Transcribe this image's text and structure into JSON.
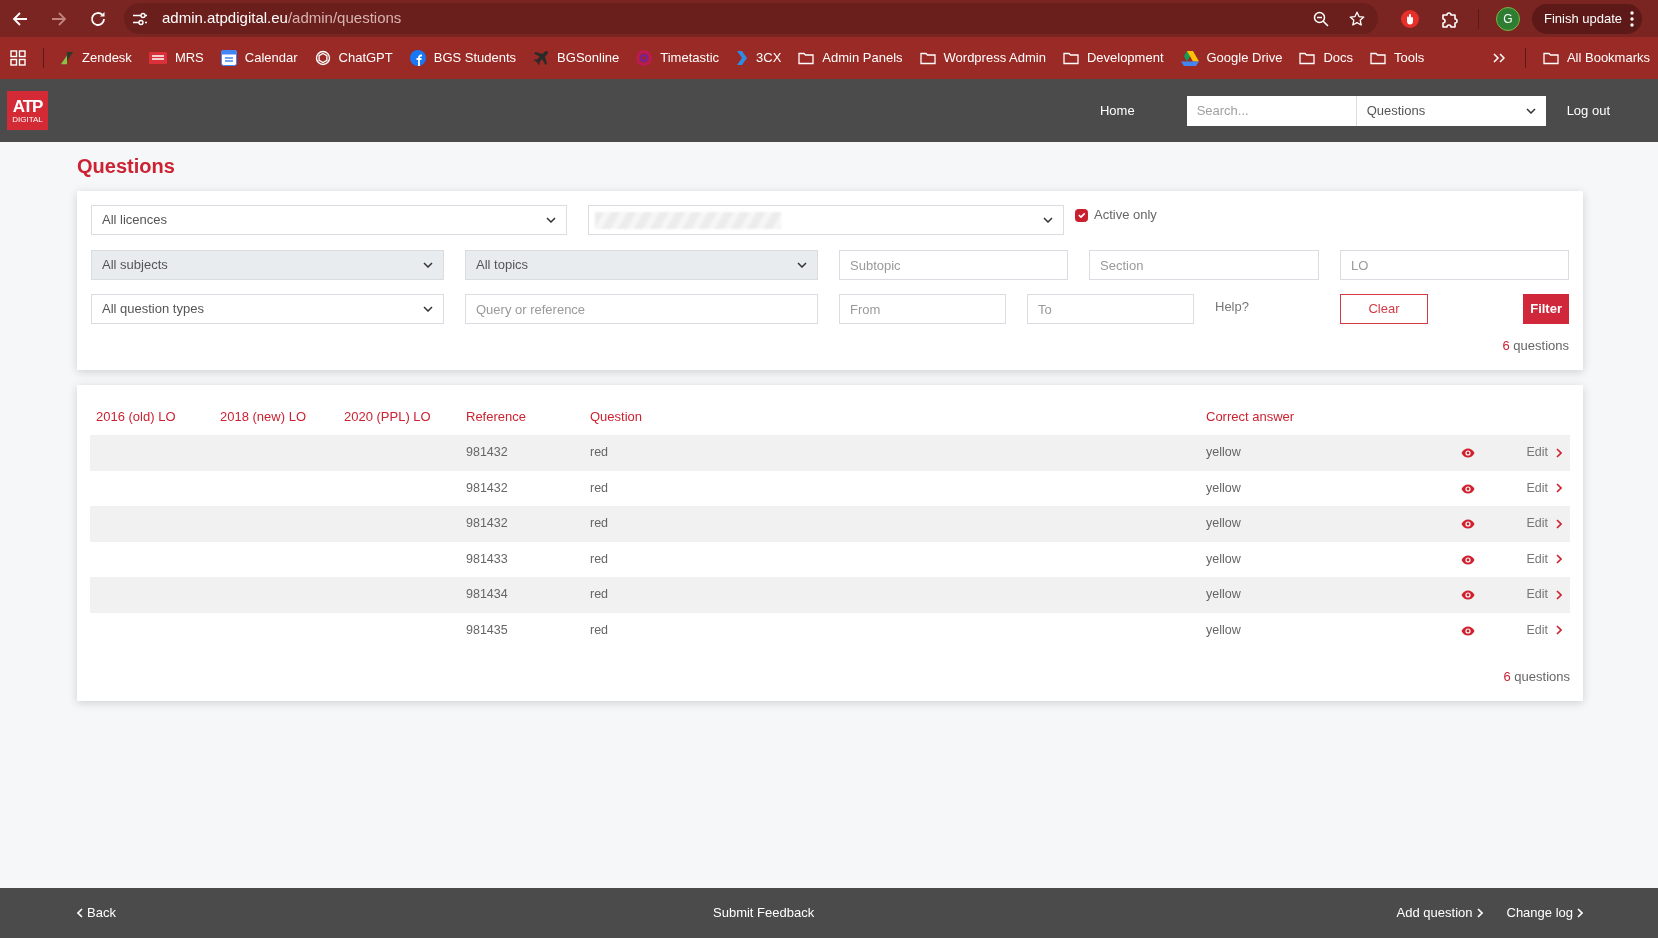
{
  "browser": {
    "back_disabled": false,
    "forward_disabled": true,
    "url_host": "admin.atpdigital.eu",
    "url_path": "/admin/questions",
    "profile_initial": "G",
    "update_button": "Finish update",
    "bookmarks": [
      {
        "label": "Zendesk",
        "kind": "site"
      },
      {
        "label": "MRS",
        "kind": "site"
      },
      {
        "label": "Calendar",
        "kind": "site"
      },
      {
        "label": "ChatGPT",
        "kind": "site"
      },
      {
        "label": "BGS Students",
        "kind": "site"
      },
      {
        "label": "BGSonline",
        "kind": "site"
      },
      {
        "label": "Timetastic",
        "kind": "site"
      },
      {
        "label": "3CX",
        "kind": "site"
      },
      {
        "label": "Admin Panels",
        "kind": "folder"
      },
      {
        "label": "Wordpress Admin",
        "kind": "folder"
      },
      {
        "label": "Development",
        "kind": "folder"
      },
      {
        "label": "Google Drive",
        "kind": "site"
      },
      {
        "label": "Docs",
        "kind": "folder"
      },
      {
        "label": "Tools",
        "kind": "folder"
      }
    ],
    "all_bookmarks": "All Bookmarks"
  },
  "app_header": {
    "logo_main": "ATP",
    "logo_sub": "DIGITAL",
    "nav_link": "Home",
    "search_placeholder": "Search...",
    "search_scope": "Questions",
    "logout": "Log out"
  },
  "page_title": "Questions",
  "filters": {
    "licence": {
      "value": "All licences",
      "disabled": false
    },
    "second_select": {
      "redacted": true,
      "disabled": false
    },
    "active_only": {
      "label": "Active only",
      "checked": true
    },
    "subject": {
      "value": "All subjects",
      "disabled": true
    },
    "topic": {
      "value": "All topics",
      "disabled": true
    },
    "subtopic_placeholder": "Subtopic",
    "section_placeholder": "Section",
    "lo_placeholder": "LO",
    "question_type": {
      "value": "All question types",
      "disabled": false
    },
    "query_placeholder": "Query or reference",
    "from_placeholder": "From",
    "to_placeholder": "To",
    "help": "Help?",
    "clear_button": "Clear",
    "filter_button": "Filter",
    "count": "6",
    "count_label": "questions"
  },
  "table": {
    "columns": [
      "2016 (old) LO",
      "2018 (new) LO",
      "2020 (PPL) LO",
      "Reference",
      "Question",
      "Correct answer"
    ],
    "rows": [
      {
        "reference": "981432",
        "question": "red",
        "correct_answer": "yellow",
        "edit": "Edit"
      },
      {
        "reference": "981432",
        "question": "red",
        "correct_answer": "yellow",
        "edit": "Edit"
      },
      {
        "reference": "981432",
        "question": "red",
        "correct_answer": "yellow",
        "edit": "Edit"
      },
      {
        "reference": "981433",
        "question": "red",
        "correct_answer": "yellow",
        "edit": "Edit"
      },
      {
        "reference": "981434",
        "question": "red",
        "correct_answer": "yellow",
        "edit": "Edit"
      },
      {
        "reference": "981435",
        "question": "red",
        "correct_answer": "yellow",
        "edit": "Edit"
      }
    ],
    "count": "6",
    "count_label": "questions"
  },
  "footer": {
    "back": "Back",
    "center": "Submit Feedback",
    "links": [
      "Add question",
      "Change log"
    ]
  }
}
